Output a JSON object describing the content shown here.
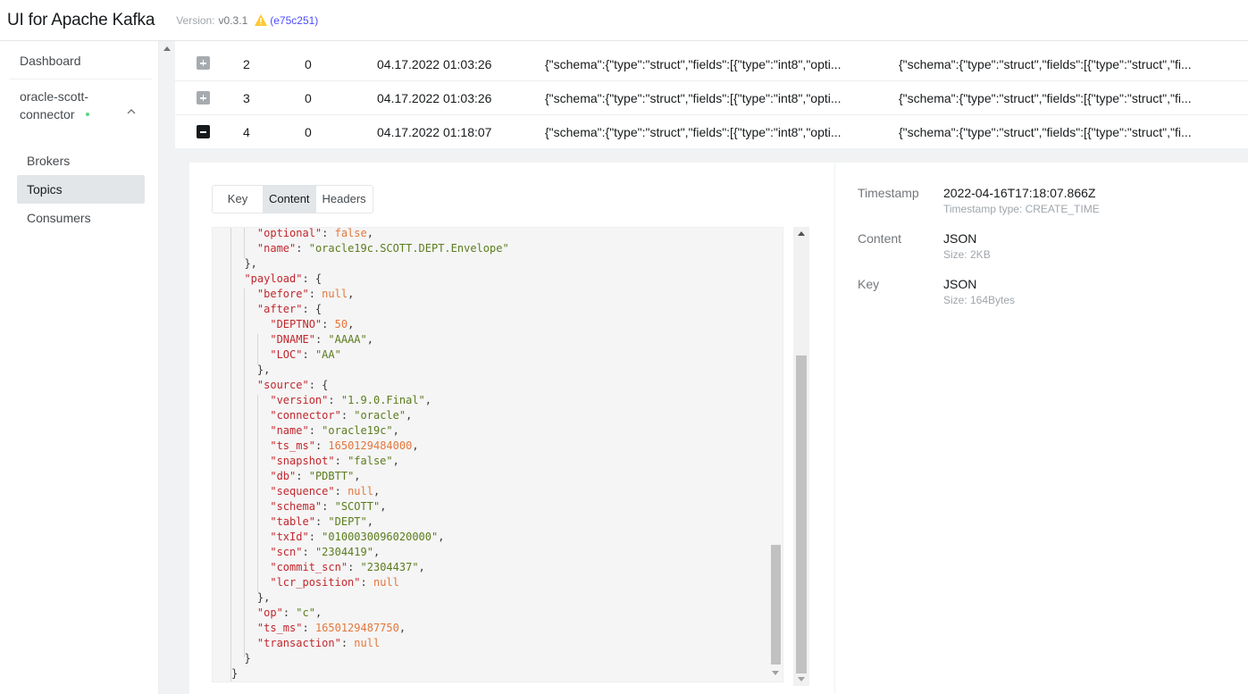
{
  "header": {
    "app_title": "UI for Apache Kafka",
    "version_label": "Version:",
    "version_value": "v0.3.1",
    "commit_hash": "e75c251",
    "warn_icon": "warning-triangle-icon"
  },
  "sidebar": {
    "dashboard": "Dashboard",
    "cluster_name": "oracle-scott-connector",
    "cluster_status_color": "#5cd685",
    "items": [
      {
        "label": "Brokers",
        "active": false
      },
      {
        "label": "Topics",
        "active": true
      },
      {
        "label": "Consumers",
        "active": false
      }
    ]
  },
  "messages": {
    "rows": [
      {
        "expanded": false,
        "offset": "2",
        "partition": "0",
        "timestamp": "04.17.2022 01:03:26",
        "key": "{\"schema\":{\"type\":\"struct\",\"fields\":[{\"type\":\"int8\",\"opti...",
        "value": "{\"schema\":{\"type\":\"struct\",\"fields\":[{\"type\":\"struct\",\"fi..."
      },
      {
        "expanded": false,
        "offset": "3",
        "partition": "0",
        "timestamp": "04.17.2022 01:03:26",
        "key": "{\"schema\":{\"type\":\"struct\",\"fields\":[{\"type\":\"int8\",\"opti...",
        "value": "{\"schema\":{\"type\":\"struct\",\"fields\":[{\"type\":\"struct\",\"fi..."
      },
      {
        "expanded": true,
        "offset": "4",
        "partition": "0",
        "timestamp": "04.17.2022 01:18:07",
        "key": "{\"schema\":{\"type\":\"struct\",\"fields\":[{\"type\":\"int8\",\"opti...",
        "value": "{\"schema\":{\"type\":\"struct\",\"fields\":[{\"type\":\"struct\",\"fi..."
      }
    ]
  },
  "detail": {
    "tabs": {
      "key": "Key",
      "content": "Content",
      "headers": "Headers",
      "active": "Content"
    },
    "code_lines": [
      [
        {
          "t": "    ",
          "c": "p"
        },
        {
          "t": "\"optional\"",
          "c": "k"
        },
        {
          "t": ": ",
          "c": "p"
        },
        {
          "t": "false",
          "c": "kw"
        },
        {
          "t": ",",
          "c": "p"
        }
      ],
      [
        {
          "t": "    ",
          "c": "p"
        },
        {
          "t": "\"name\"",
          "c": "k"
        },
        {
          "t": ": ",
          "c": "p"
        },
        {
          "t": "\"oracle19c.SCOTT.DEPT.Envelope\"",
          "c": "s"
        }
      ],
      [
        {
          "t": "  },",
          "c": "p"
        }
      ],
      [
        {
          "t": "  ",
          "c": "p"
        },
        {
          "t": "\"payload\"",
          "c": "k"
        },
        {
          "t": ": {",
          "c": "p"
        }
      ],
      [
        {
          "t": "    ",
          "c": "p"
        },
        {
          "t": "\"before\"",
          "c": "k"
        },
        {
          "t": ": ",
          "c": "p"
        },
        {
          "t": "null",
          "c": "kw"
        },
        {
          "t": ",",
          "c": "p"
        }
      ],
      [
        {
          "t": "    ",
          "c": "p"
        },
        {
          "t": "\"after\"",
          "c": "k"
        },
        {
          "t": ": {",
          "c": "p"
        }
      ],
      [
        {
          "t": "      ",
          "c": "p"
        },
        {
          "t": "\"DEPTNO\"",
          "c": "k"
        },
        {
          "t": ": ",
          "c": "p"
        },
        {
          "t": "50",
          "c": "n"
        },
        {
          "t": ",",
          "c": "p"
        }
      ],
      [
        {
          "t": "      ",
          "c": "p"
        },
        {
          "t": "\"DNAME\"",
          "c": "k"
        },
        {
          "t": ": ",
          "c": "p"
        },
        {
          "t": "\"AAAA\"",
          "c": "s"
        },
        {
          "t": ",",
          "c": "p"
        }
      ],
      [
        {
          "t": "      ",
          "c": "p"
        },
        {
          "t": "\"LOC\"",
          "c": "k"
        },
        {
          "t": ": ",
          "c": "p"
        },
        {
          "t": "\"AA\"",
          "c": "s"
        }
      ],
      [
        {
          "t": "    },",
          "c": "p"
        }
      ],
      [
        {
          "t": "    ",
          "c": "p"
        },
        {
          "t": "\"source\"",
          "c": "k"
        },
        {
          "t": ": {",
          "c": "p"
        }
      ],
      [
        {
          "t": "      ",
          "c": "p"
        },
        {
          "t": "\"version\"",
          "c": "k"
        },
        {
          "t": ": ",
          "c": "p"
        },
        {
          "t": "\"1.9.0.Final\"",
          "c": "s"
        },
        {
          "t": ",",
          "c": "p"
        }
      ],
      [
        {
          "t": "      ",
          "c": "p"
        },
        {
          "t": "\"connector\"",
          "c": "k"
        },
        {
          "t": ": ",
          "c": "p"
        },
        {
          "t": "\"oracle\"",
          "c": "s"
        },
        {
          "t": ",",
          "c": "p"
        }
      ],
      [
        {
          "t": "      ",
          "c": "p"
        },
        {
          "t": "\"name\"",
          "c": "k"
        },
        {
          "t": ": ",
          "c": "p"
        },
        {
          "t": "\"oracle19c\"",
          "c": "s"
        },
        {
          "t": ",",
          "c": "p"
        }
      ],
      [
        {
          "t": "      ",
          "c": "p"
        },
        {
          "t": "\"ts_ms\"",
          "c": "k"
        },
        {
          "t": ": ",
          "c": "p"
        },
        {
          "t": "1650129484000",
          "c": "n"
        },
        {
          "t": ",",
          "c": "p"
        }
      ],
      [
        {
          "t": "      ",
          "c": "p"
        },
        {
          "t": "\"snapshot\"",
          "c": "k"
        },
        {
          "t": ": ",
          "c": "p"
        },
        {
          "t": "\"false\"",
          "c": "s"
        },
        {
          "t": ",",
          "c": "p"
        }
      ],
      [
        {
          "t": "      ",
          "c": "p"
        },
        {
          "t": "\"db\"",
          "c": "k"
        },
        {
          "t": ": ",
          "c": "p"
        },
        {
          "t": "\"PDBTT\"",
          "c": "s"
        },
        {
          "t": ",",
          "c": "p"
        }
      ],
      [
        {
          "t": "      ",
          "c": "p"
        },
        {
          "t": "\"sequence\"",
          "c": "k"
        },
        {
          "t": ": ",
          "c": "p"
        },
        {
          "t": "null",
          "c": "kw"
        },
        {
          "t": ",",
          "c": "p"
        }
      ],
      [
        {
          "t": "      ",
          "c": "p"
        },
        {
          "t": "\"schema\"",
          "c": "k"
        },
        {
          "t": ": ",
          "c": "p"
        },
        {
          "t": "\"SCOTT\"",
          "c": "s"
        },
        {
          "t": ",",
          "c": "p"
        }
      ],
      [
        {
          "t": "      ",
          "c": "p"
        },
        {
          "t": "\"table\"",
          "c": "k"
        },
        {
          "t": ": ",
          "c": "p"
        },
        {
          "t": "\"DEPT\"",
          "c": "s"
        },
        {
          "t": ",",
          "c": "p"
        }
      ],
      [
        {
          "t": "      ",
          "c": "p"
        },
        {
          "t": "\"txId\"",
          "c": "k"
        },
        {
          "t": ": ",
          "c": "p"
        },
        {
          "t": "\"0100030096020000\"",
          "c": "s"
        },
        {
          "t": ",",
          "c": "p"
        }
      ],
      [
        {
          "t": "      ",
          "c": "p"
        },
        {
          "t": "\"scn\"",
          "c": "k"
        },
        {
          "t": ": ",
          "c": "p"
        },
        {
          "t": "\"2304419\"",
          "c": "s"
        },
        {
          "t": ",",
          "c": "p"
        }
      ],
      [
        {
          "t": "      ",
          "c": "p"
        },
        {
          "t": "\"commit_scn\"",
          "c": "k"
        },
        {
          "t": ": ",
          "c": "p"
        },
        {
          "t": "\"2304437\"",
          "c": "s"
        },
        {
          "t": ",",
          "c": "p"
        }
      ],
      [
        {
          "t": "      ",
          "c": "p"
        },
        {
          "t": "\"lcr_position\"",
          "c": "k"
        },
        {
          "t": ": ",
          "c": "p"
        },
        {
          "t": "null",
          "c": "kw"
        }
      ],
      [
        {
          "t": "    },",
          "c": "p"
        }
      ],
      [
        {
          "t": "    ",
          "c": "p"
        },
        {
          "t": "\"op\"",
          "c": "k"
        },
        {
          "t": ": ",
          "c": "p"
        },
        {
          "t": "\"c\"",
          "c": "s"
        },
        {
          "t": ",",
          "c": "p"
        }
      ],
      [
        {
          "t": "    ",
          "c": "p"
        },
        {
          "t": "\"ts_ms\"",
          "c": "k"
        },
        {
          "t": ": ",
          "c": "p"
        },
        {
          "t": "1650129487750",
          "c": "n"
        },
        {
          "t": ",",
          "c": "p"
        }
      ],
      [
        {
          "t": "    ",
          "c": "p"
        },
        {
          "t": "\"transaction\"",
          "c": "k"
        },
        {
          "t": ": ",
          "c": "p"
        },
        {
          "t": "null",
          "c": "kw"
        }
      ],
      [
        {
          "t": "  }",
          "c": "p"
        }
      ],
      [
        {
          "t": "}",
          "c": "p"
        }
      ]
    ],
    "meta": [
      {
        "label": "Timestamp",
        "value": "2022-04-16T17:18:07.866Z",
        "sub": "Timestamp type: CREATE_TIME"
      },
      {
        "label": "Content",
        "value": "JSON",
        "sub": "Size: 2KB"
      },
      {
        "label": "Key",
        "value": "JSON",
        "sub": "Size: 164Bytes"
      }
    ]
  },
  "colors": {
    "json_key": "#c1272d",
    "json_string": "#5b7c1e",
    "json_number": "#e2773e",
    "accent_link": "#4c4cff",
    "warning": "#ffc933"
  }
}
